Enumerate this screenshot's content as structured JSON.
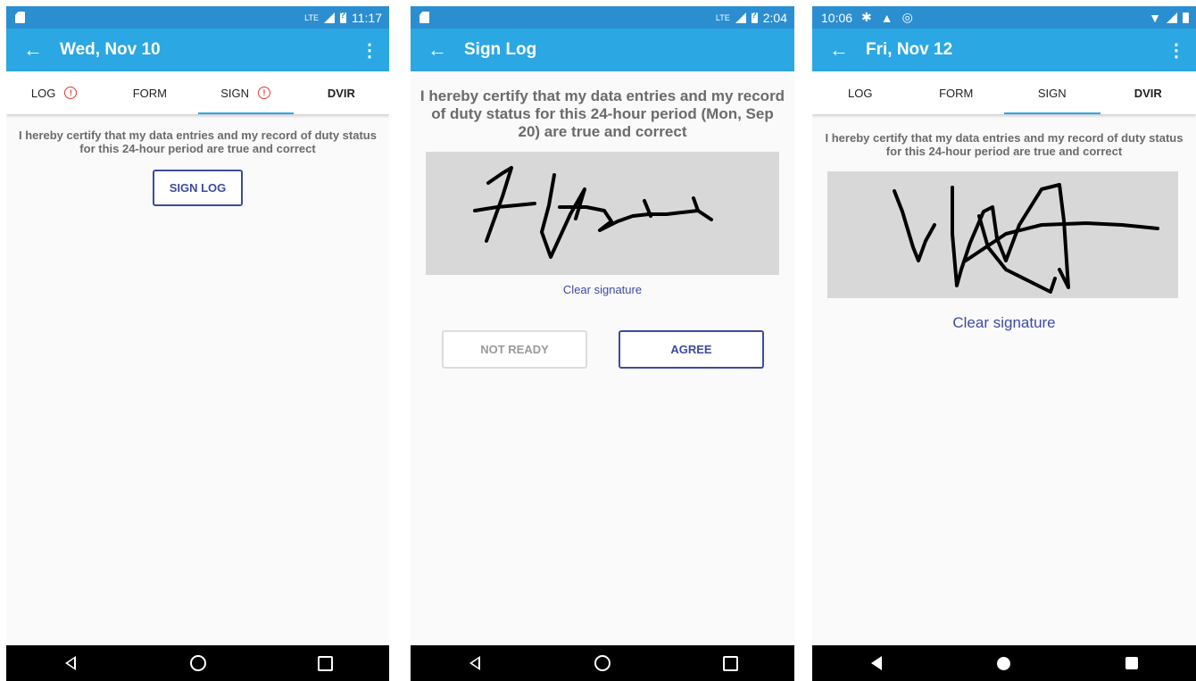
{
  "screen1": {
    "status_time": "11:17",
    "title": "Wed, Nov 10",
    "tabs": [
      "LOG",
      "FORM",
      "SIGN",
      "DVIR"
    ],
    "certify_text": "I hereby certify that my data entries and my record of duty status for this 24-hour period are true and correct",
    "sign_button": "SIGN LOG"
  },
  "screen2": {
    "status_time": "2:04",
    "title": "Sign Log",
    "certify_text": "I hereby certify that my data entries and my record of duty status for this 24-hour period (Mon, Sep 20) are true and correct",
    "clear_signature": "Clear signature",
    "not_ready_button": "NOT READY",
    "agree_button": "AGREE"
  },
  "screen3": {
    "status_time": "10:06",
    "title": "Fri, Nov 12",
    "tabs": [
      "LOG",
      "FORM",
      "SIGN",
      "DVIR"
    ],
    "certify_text": "I hereby certify that my data entries and my record of duty status for this 24-hour period are true and correct",
    "clear_signature": "Clear signature"
  },
  "colors": {
    "status_bar": "#2b8ed1",
    "app_bar": "#2ba7e3",
    "accent": "#3c4ba0",
    "alert": "#e53935"
  },
  "icons": [
    "back-arrow-icon",
    "overflow-menu-icon",
    "alert-icon",
    "nav-back-icon",
    "nav-home-icon",
    "nav-recents-icon",
    "sd-card-icon",
    "lte-signal-icon",
    "battery-icon",
    "settings-icon",
    "warning-icon",
    "sync-icon",
    "wifi-icon"
  ]
}
